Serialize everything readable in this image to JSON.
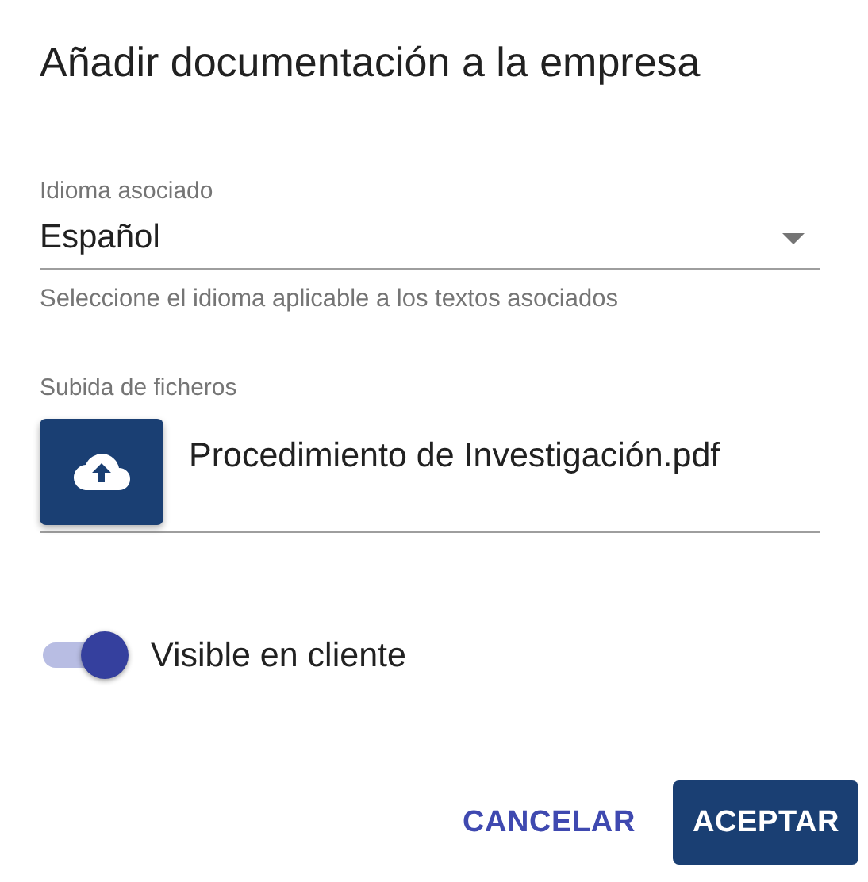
{
  "dialog": {
    "title": "Añadir documentación a la empresa"
  },
  "language_select": {
    "label": "Idioma asociado",
    "value": "Español",
    "hint": "Seleccione el idioma aplicable a los textos asociados"
  },
  "file_upload": {
    "label": "Subida de ficheros",
    "file_name": "Procedimiento de Investigación.pdf"
  },
  "visible_toggle": {
    "label": "Visible en cliente",
    "on": true
  },
  "buttons": [
    {
      "label": "CANCELAR",
      "kind": "text"
    },
    {
      "label": "ACEPTAR",
      "kind": "filled"
    }
  ]
}
